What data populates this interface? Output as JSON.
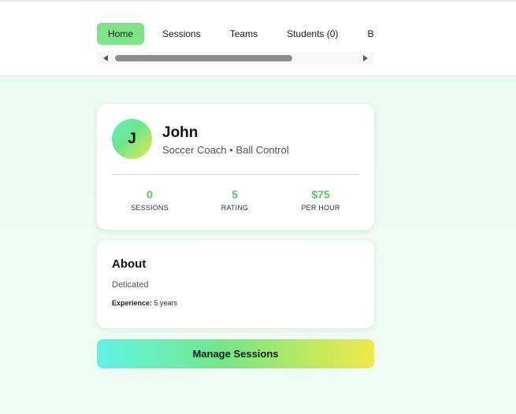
{
  "nav": {
    "tabs": [
      {
        "label": "Home",
        "active": true
      },
      {
        "label": "Sessions",
        "active": false
      },
      {
        "label": "Teams",
        "active": false
      },
      {
        "label": "Students (0)",
        "active": false
      },
      {
        "label": "Book",
        "active": false
      }
    ]
  },
  "profile": {
    "initial": "J",
    "name": "John",
    "subtitle": "Soccer Coach • Ball Control",
    "stats": [
      {
        "value": "0",
        "label": "SESSIONS"
      },
      {
        "value": "5",
        "label": "RATING"
      },
      {
        "value": "$75",
        "label": "PER HOUR"
      }
    ]
  },
  "about": {
    "title": "About",
    "text": "Deticated",
    "experience_label": "Experience:",
    "experience_value": "5 years"
  },
  "actions": {
    "manage_label": "Manage Sessions"
  },
  "colors": {
    "accent_green": "#7ee387",
    "stat_green": "#5cc466",
    "page_background": "#eafaf1"
  }
}
